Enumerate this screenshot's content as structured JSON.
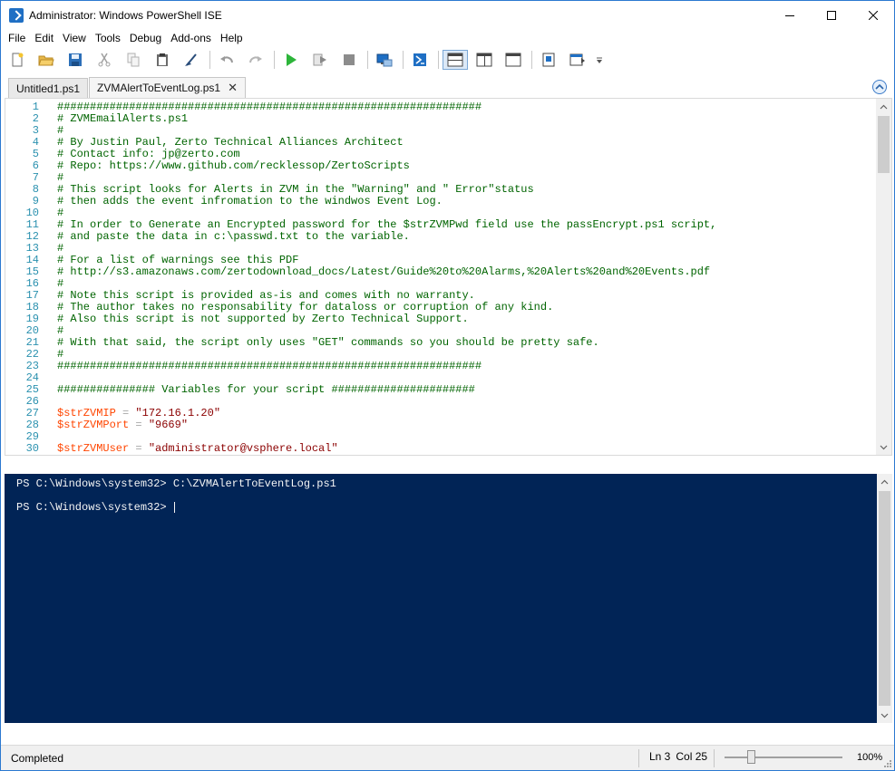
{
  "window": {
    "title": "Administrator: Windows PowerShell ISE"
  },
  "menu": [
    "File",
    "Edit",
    "View",
    "Tools",
    "Debug",
    "Add-ons",
    "Help"
  ],
  "toolbar": {
    "icons": [
      "new-file-icon",
      "open-folder-icon",
      "save-icon",
      "cut-icon",
      "copy-icon",
      "paste-icon",
      "clear-console-icon",
      "undo-icon",
      "redo-icon",
      "run-script-icon",
      "run-selection-icon",
      "stop-icon",
      "new-remote-tab-icon",
      "start-powershell-icon",
      "show-script-top-icon",
      "show-script-right-icon",
      "show-script-max-icon",
      "show-script-pane-icon",
      "show-commands-icon"
    ]
  },
  "tabs": [
    {
      "label": "Untitled1.ps1",
      "active": false
    },
    {
      "label": "ZVMAlertToEventLog.ps1",
      "active": true
    }
  ],
  "script": {
    "lines": [
      {
        "n": "1",
        "text": "#################################################################"
      },
      {
        "n": "2",
        "text": "# ZVMEmailAlerts.ps1"
      },
      {
        "n": "3",
        "text": "#"
      },
      {
        "n": "4",
        "text": "# By Justin Paul, Zerto Technical Alliances Architect"
      },
      {
        "n": "5",
        "text": "# Contact info: jp@zerto.com"
      },
      {
        "n": "6",
        "text": "# Repo: https://www.github.com/recklessop/ZertoScripts"
      },
      {
        "n": "7",
        "text": "#"
      },
      {
        "n": "8",
        "text": "# This script looks for Alerts in ZVM in the \"Warning\" and \" Error\"status"
      },
      {
        "n": "9",
        "text": "# then adds the event infromation to the windwos Event Log."
      },
      {
        "n": "10",
        "text": "#"
      },
      {
        "n": "11",
        "text": "# In order to Generate an Encrypted password for the $strZVMPwd field use the passEncrypt.ps1 script,"
      },
      {
        "n": "12",
        "text": "# and paste the data in c:\\passwd.txt to the variable."
      },
      {
        "n": "13",
        "text": "#"
      },
      {
        "n": "14",
        "text": "# For a list of warnings see this PDF"
      },
      {
        "n": "15",
        "text": "# http://s3.amazonaws.com/zertodownload_docs/Latest/Guide%20to%20Alarms,%20Alerts%20and%20Events.pdf"
      },
      {
        "n": "16",
        "text": "#"
      },
      {
        "n": "17",
        "text": "# Note this script is provided as-is and comes with no warranty."
      },
      {
        "n": "18",
        "text": "# The author takes no responsability for dataloss or corruption of any kind."
      },
      {
        "n": "19",
        "text": "# Also this script is not supported by Zerto Technical Support."
      },
      {
        "n": "20",
        "text": "#"
      },
      {
        "n": "21",
        "text": "# With that said, the script only uses \"GET\" commands so you should be pretty safe."
      },
      {
        "n": "22",
        "text": "#"
      },
      {
        "n": "23",
        "text": "#################################################################"
      },
      {
        "n": "24",
        "text": ""
      },
      {
        "n": "25",
        "text": "############### Variables for your script ######################"
      },
      {
        "n": "26",
        "text": ""
      }
    ],
    "assignments": [
      {
        "n": "27",
        "var": "$strZVMIP",
        "op": " = ",
        "value": "\"172.16.1.20\""
      },
      {
        "n": "28",
        "var": "$strZVMPort",
        "op": " = ",
        "value": "\"9669\""
      },
      {
        "n": "29",
        "var": "",
        "op": "",
        "value": ""
      },
      {
        "n": "30",
        "var": "$strZVMUser",
        "op": " = ",
        "value": "\"administrator@vsphere.local\""
      }
    ]
  },
  "console": {
    "line1": "PS C:\\Windows\\system32> C:\\ZVMAlertToEventLog.ps1",
    "line2": "PS C:\\Windows\\system32> "
  },
  "status": {
    "text": "Completed",
    "ln": "Ln 3",
    "col": "Col 25",
    "zoom": "100%",
    "zoom_level": 1.0
  }
}
